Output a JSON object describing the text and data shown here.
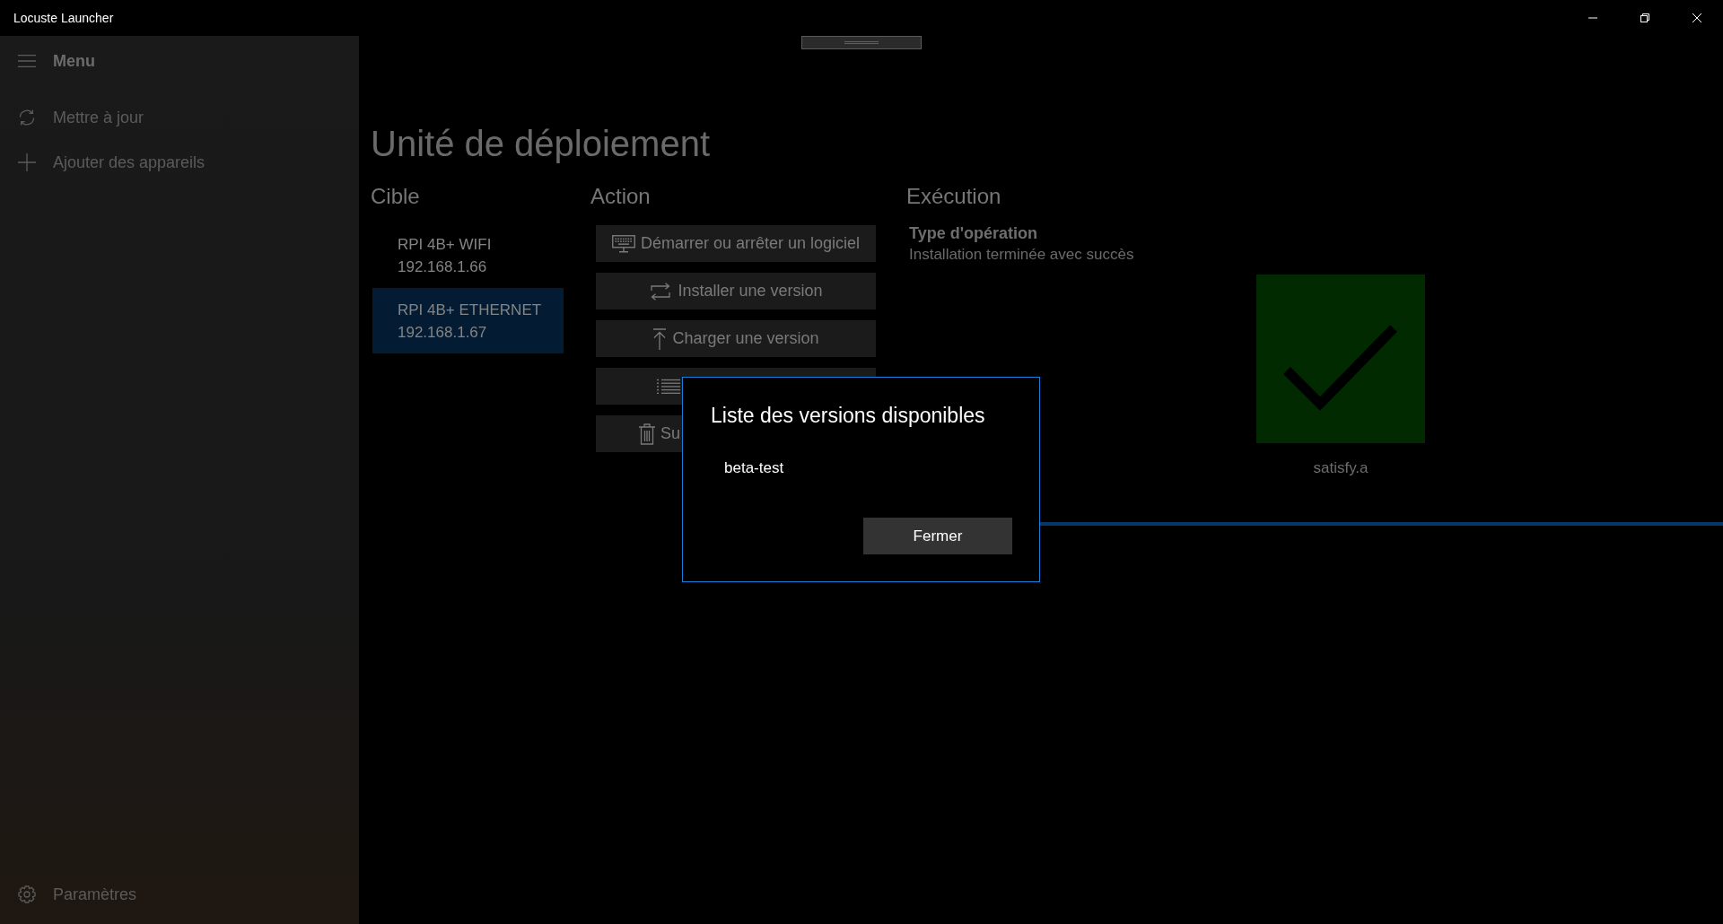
{
  "window": {
    "title": "Locuste Launcher"
  },
  "sidebar": {
    "title": "Menu",
    "items": [
      {
        "label": "Mettre à jour",
        "selected": false
      },
      {
        "label": "Ajouter des appareils",
        "selected": false
      }
    ],
    "footer_items": [
      {
        "label": "Paramètres",
        "selected": false
      }
    ]
  },
  "page": {
    "title": "Unité de déploiement"
  },
  "targets": {
    "heading": "Cible",
    "items": [
      {
        "name": "RPI 4B+ WIFI",
        "address": "192.168.1.66",
        "selected": false
      },
      {
        "name": "RPI 4B+ ETHERNET",
        "address": "192.168.1.67",
        "selected": true
      }
    ]
  },
  "actions": {
    "heading": "Action",
    "buttons": [
      {
        "kind": "full",
        "label": "Démarrer ou arrêter un logiciel"
      },
      {
        "kind": "full",
        "label": "Installer une version"
      },
      {
        "kind": "full",
        "label": "Charger une version"
      },
      {
        "kind": "covered"
      },
      {
        "kind": "covered",
        "label": "Su"
      }
    ]
  },
  "execution": {
    "heading": "Exécution",
    "operation_label": "Type d'opération",
    "operation_status": "Installation terminée avec succès",
    "result": {
      "succeeded": true,
      "name": "satisfy.a"
    },
    "progress": {
      "level": 1
    }
  },
  "dialog": {
    "title": "Liste des versions disponibles",
    "versions": [
      {
        "label": "beta-test",
        "selected": false
      }
    ],
    "close_button": "Fermer"
  }
}
